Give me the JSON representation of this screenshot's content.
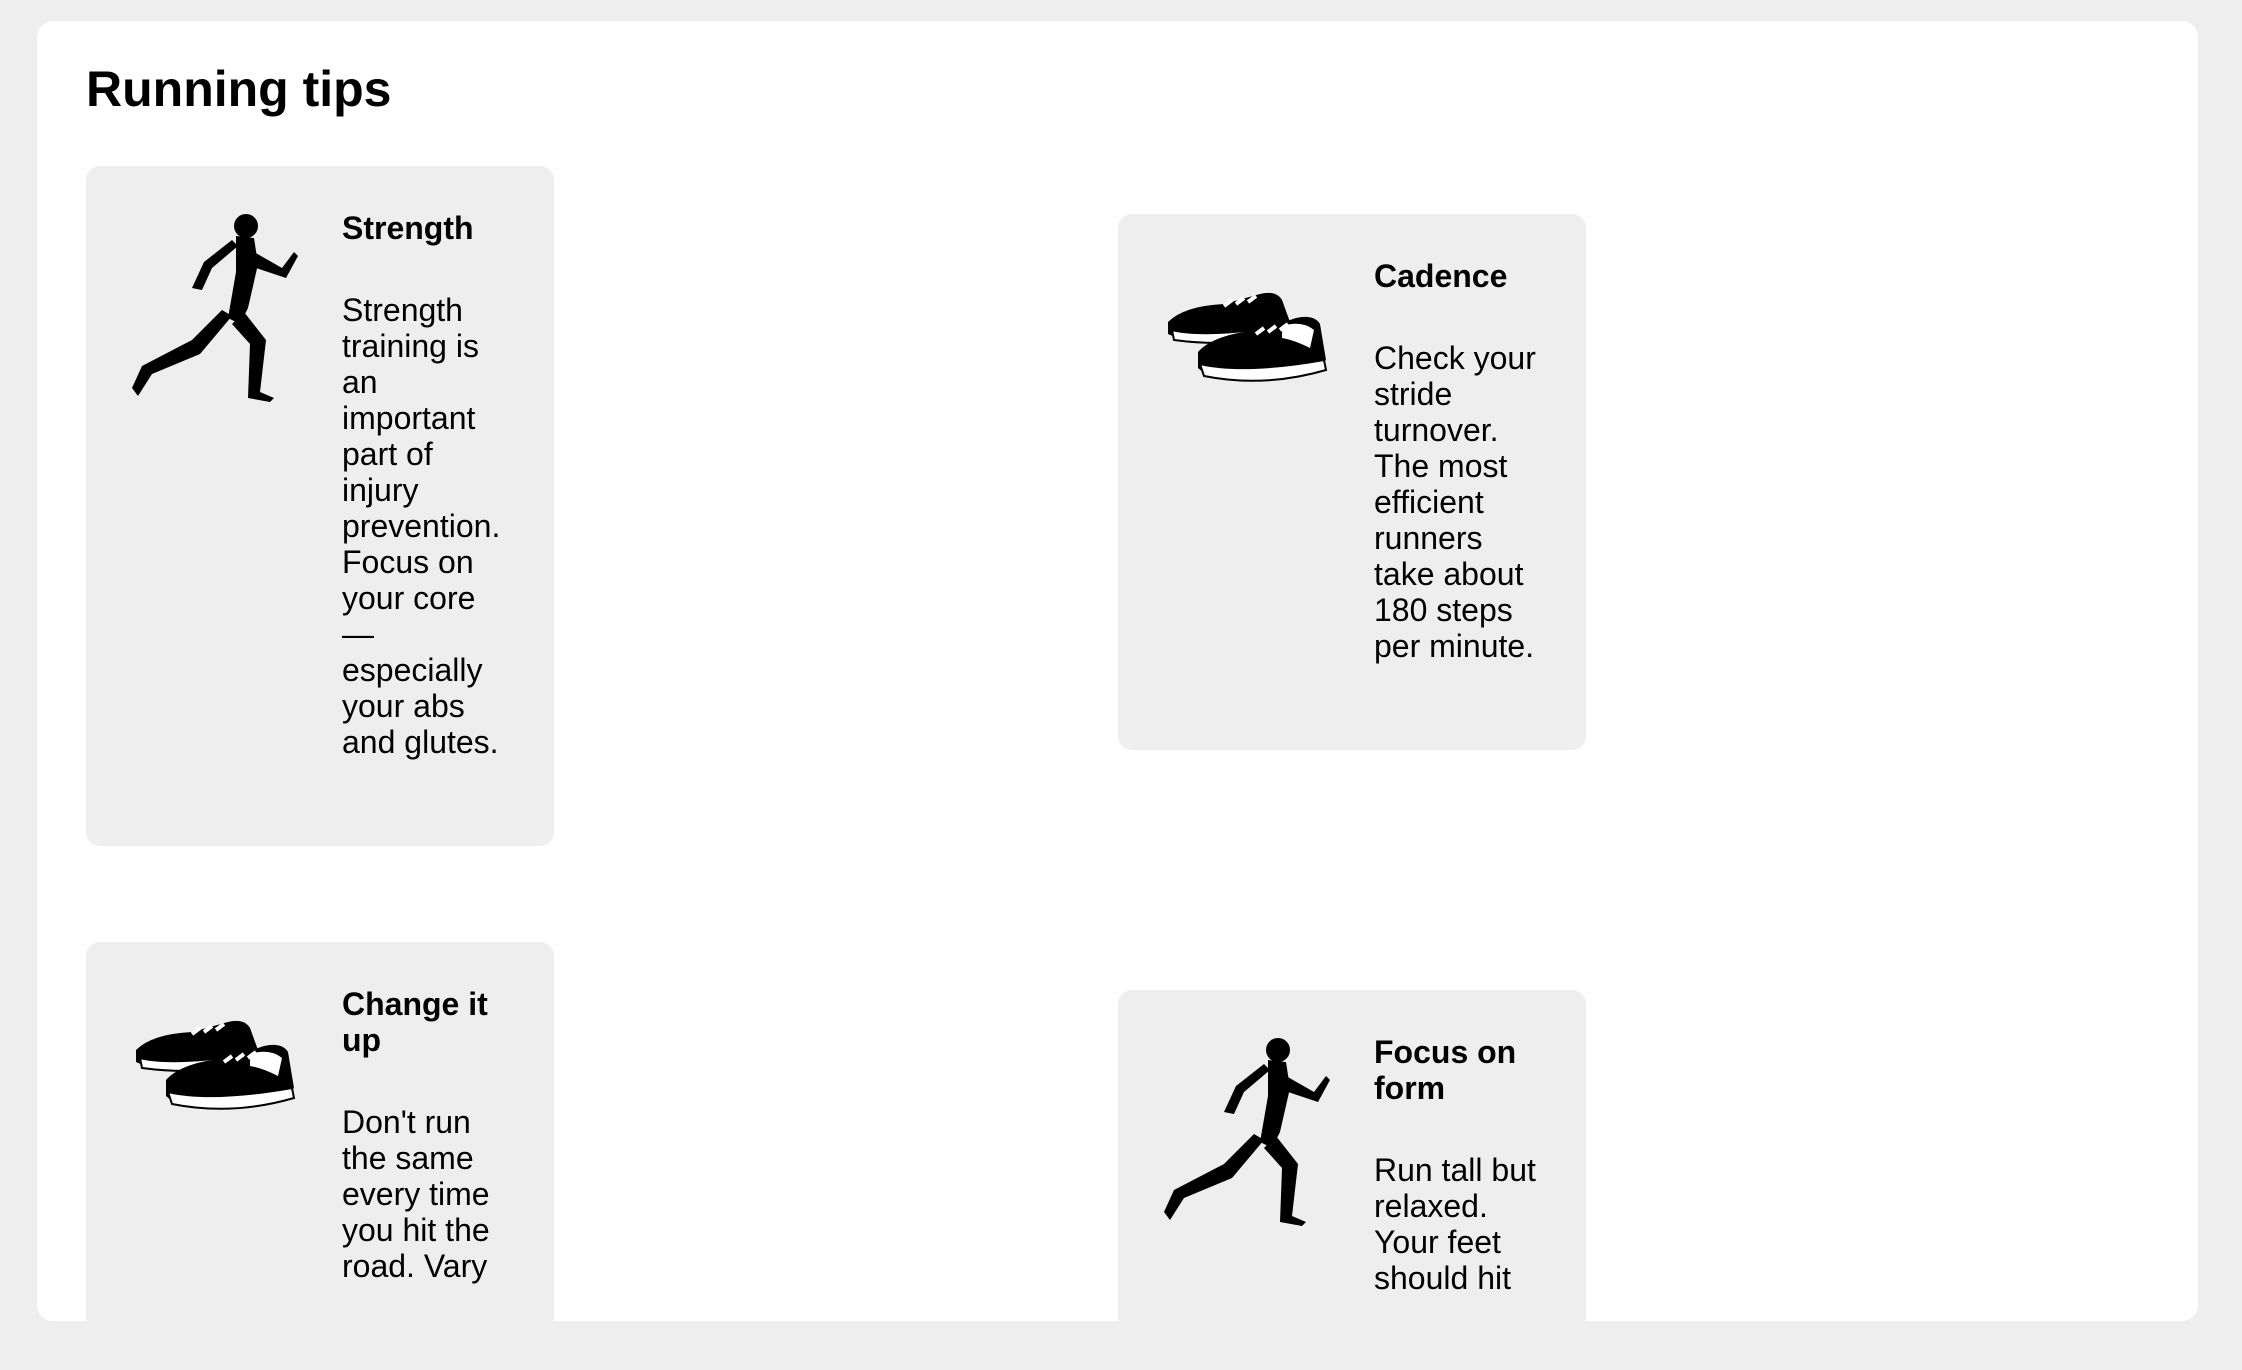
{
  "page": {
    "title": "Running tips"
  },
  "cards": [
    {
      "icon": "runner-icon",
      "heading": "Strength",
      "body": "Strength training is an important part of injury prevention. Focus on your core — especially your abs and glutes."
    },
    {
      "icon": "sneakers-icon",
      "heading": "Cadence",
      "body": "Check your stride turnover. The most efficient runners take about 180 steps per minute."
    },
    {
      "icon": "sneakers-icon",
      "heading": "Change it up",
      "body": "Don't run the same every time you hit the road. Vary"
    },
    {
      "icon": "runner-icon",
      "heading": "Focus on form",
      "body": "Run tall but relaxed. Your feet should hit"
    }
  ]
}
